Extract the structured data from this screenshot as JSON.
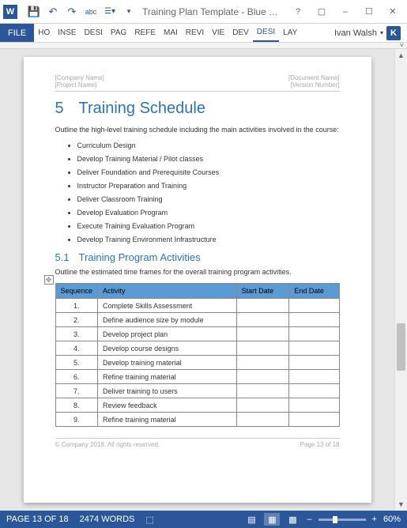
{
  "app": {
    "title": "Training Plan Template - Blue Them..."
  },
  "qat": {
    "save": "💾",
    "undo": "↶",
    "redo": "↷",
    "spell": "abc",
    "touch": "☰▾",
    "more": "▾"
  },
  "tabs": {
    "file": "FILE",
    "list": [
      "HO",
      "INSE",
      "DESI",
      "PAG",
      "REFE",
      "MAI",
      "REVI",
      "VIE",
      "DEV",
      "DESI",
      "LAY"
    ],
    "activeIndex": 9
  },
  "user": {
    "name": "Ivan Walsh",
    "initial": "K"
  },
  "winControls": {
    "help": "?",
    "ribbon": "▢",
    "min": "–",
    "max": "☐",
    "close": "✕"
  },
  "doc": {
    "header": {
      "left1": "[Company Name]",
      "left2": "[Project Name]",
      "right1": "[Document Name]",
      "right2": "[Version Number]"
    },
    "h1": {
      "num": "5",
      "text": "Training Schedule"
    },
    "intro": "Outline the high-level training schedule including the main activities involved in the course:",
    "bullets": [
      "Curriculum Design",
      "Develop Training Material / Pilot classes",
      "Deliver Foundation and Prerequisite Courses",
      "Instructor Preparation and Training",
      "Deliver Classroom Training",
      "Develop Evaluation Program",
      "Execute Training Evaluation Program",
      "Develop Training Environment Infrastructure"
    ],
    "h2": {
      "num": "5.1",
      "text": "Training Program Activities"
    },
    "intro2": "Outline the estimated time frames for the overall training program activities.",
    "table": {
      "headers": [
        "Sequence",
        "Activity",
        "Start Date",
        "End Date"
      ],
      "rows": [
        {
          "seq": "1.",
          "activity": "Complete Skills Assessment"
        },
        {
          "seq": "2.",
          "activity": "Define audience size by module"
        },
        {
          "seq": "3.",
          "activity": "Develop project plan"
        },
        {
          "seq": "4.",
          "activity": "Develop course designs"
        },
        {
          "seq": "5.",
          "activity": "Develop training material"
        },
        {
          "seq": "6.",
          "activity": "Refine training material"
        },
        {
          "seq": "7.",
          "activity": "Deliver training to users"
        },
        {
          "seq": "8.",
          "activity": "Review feedback"
        },
        {
          "seq": "9.",
          "activity": "Refine training material"
        }
      ]
    },
    "footer": {
      "left": "© Company 2018. All rights reserved.",
      "right": "Page 13 of 18"
    }
  },
  "status": {
    "page": "PAGE 13 OF 18",
    "words": "2474 WORDS",
    "lang": "⬚",
    "zoom": "60%"
  }
}
